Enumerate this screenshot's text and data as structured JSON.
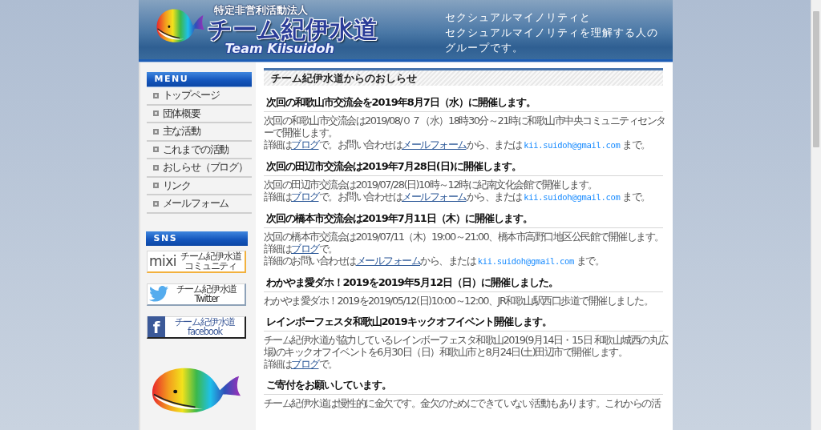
{
  "header": {
    "org_type": "特定非営利活動法人",
    "site_name": "チーム紀伊水道",
    "site_name_roman": "Team Kiisuidoh",
    "tagline_lines": [
      "セクシュアルマイノリティと",
      "セクシュアルマイノリティを理解する人の",
      "グループです。"
    ]
  },
  "sidebar": {
    "menu": {
      "title": "MENU",
      "items": [
        {
          "label": "トップページ"
        },
        {
          "label": "団体概要"
        },
        {
          "label": "主な活動"
        },
        {
          "label": "これまでの活動"
        },
        {
          "label": "おしらせ（ブログ）"
        },
        {
          "label": "リンク"
        },
        {
          "label": "メールフォーム"
        }
      ]
    },
    "sns": {
      "title": "SNS",
      "banners": [
        {
          "kind": "mixi",
          "logo": "mixi",
          "label_lines": [
            "チーム紀伊水道",
            "コミュニティ"
          ]
        },
        {
          "kind": "twitter",
          "label_lines": [
            "チーム紀伊水道",
            "Twitter"
          ]
        },
        {
          "kind": "facebook",
          "logo": "f",
          "label_lines": [
            "チーム紀伊水道",
            "facebook"
          ]
        }
      ]
    }
  },
  "main": {
    "title": "チーム紀伊水道からのおしらせ",
    "news": [
      {
        "heading": "次回の和歌山市交流会を2019年8月7日（水）に開催します。",
        "paragraphs": [
          [
            {
              "kind": "text",
              "text": "次回の和歌山市交流会は2019/08/０７（水）18時30分～21時に和歌山市中央コミュニティセンターで開催します。"
            }
          ],
          [
            {
              "kind": "text",
              "text": "詳細は"
            },
            {
              "kind": "link",
              "text": "ブログ"
            },
            {
              "kind": "text",
              "text": "で。お問い合わせは"
            },
            {
              "kind": "link",
              "text": "メールフォーム"
            },
            {
              "kind": "text",
              "text": "から、または "
            },
            {
              "kind": "email",
              "text": "kii.suidoh@gmail.com"
            },
            {
              "kind": "text",
              "text": " まで。"
            }
          ]
        ]
      },
      {
        "heading": "次回の田辺市交流会は2019年7月28日(日)に開催します。",
        "paragraphs": [
          [
            {
              "kind": "text",
              "text": "次回の田辺市交流会は2019/07/28(日)10時～12時に紀南文化会館で開催します。"
            }
          ],
          [
            {
              "kind": "text",
              "text": "詳細は"
            },
            {
              "kind": "link",
              "text": "ブログ"
            },
            {
              "kind": "text",
              "text": "で。お問い合わせは"
            },
            {
              "kind": "link",
              "text": "メールフォーム"
            },
            {
              "kind": "text",
              "text": "から、または "
            },
            {
              "kind": "email",
              "text": "kii.suidoh@gmail.com"
            },
            {
              "kind": "text",
              "text": " まで。"
            }
          ]
        ]
      },
      {
        "heading": "次回の橋本市交流会は2019年7月11日（木）に開催します。",
        "paragraphs": [
          [
            {
              "kind": "text",
              "text": "次回の橋本市交流会は2019/07/11（木）19:00～21:00、橋本市高野口地区公民館で開催します。詳細は"
            },
            {
              "kind": "link",
              "text": "ブログ"
            },
            {
              "kind": "text",
              "text": "で。"
            }
          ],
          [
            {
              "kind": "text",
              "text": "詳細のお問い合わせは"
            },
            {
              "kind": "link",
              "text": "メールフォーム"
            },
            {
              "kind": "text",
              "text": "から、または "
            },
            {
              "kind": "email",
              "text": "kii.suidoh@gmail.com"
            },
            {
              "kind": "text",
              "text": " まで。"
            }
          ]
        ]
      },
      {
        "heading": "わかやま愛ダホ！2019を2019年5月12日（日）に開催しました。",
        "paragraphs": [
          [
            {
              "kind": "text",
              "text": "わかやま愛ダホ！2019を2019/05/12(日)10:00～12:00、JR和歌山駅西口歩道で開催しました。"
            }
          ]
        ]
      },
      {
        "heading": "レインボーフェスタ和歌山2019キックオフイベント開催します。",
        "paragraphs": [
          [
            {
              "kind": "text",
              "text": "チーム紀伊水道が協力しているレインボーフェスタ和歌山2019(9月14日・15日 和歌山城西の丸広場)のキックオフイベントを6月30日（日）和歌山市と8月24日(土)田辺市で開催します。"
            }
          ],
          [
            {
              "kind": "text",
              "text": "詳細は"
            },
            {
              "kind": "link",
              "text": "ブログ"
            },
            {
              "kind": "text",
              "text": "で。"
            }
          ]
        ]
      },
      {
        "heading": "ご寄付をお願いしています。",
        "paragraphs": [
          [
            {
              "kind": "text",
              "text": "チーム紀伊水道は慢性的に金欠です。金欠のためにできていない活動もあります。これからの活"
            }
          ]
        ]
      }
    ]
  }
}
